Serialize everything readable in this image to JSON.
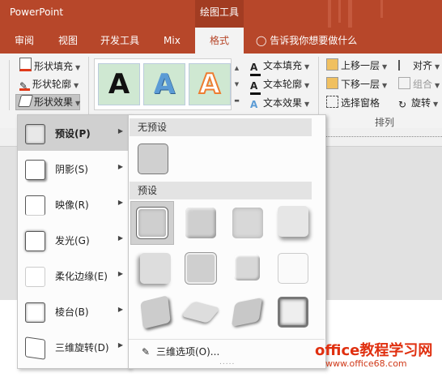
{
  "app": {
    "title": "PowerPoint",
    "context_tab": "绘图工具"
  },
  "tabs": [
    {
      "label": "审阅"
    },
    {
      "label": "视图"
    },
    {
      "label": "开发工具"
    },
    {
      "label": "Mix"
    },
    {
      "label": "格式"
    }
  ],
  "tell_me": "告诉我你想要做什么",
  "ribbon": {
    "shape_fill": "形状填充",
    "shape_outline": "形状轮廓",
    "shape_effects": "形状效果",
    "text_fill": "文本填充",
    "text_outline": "文本轮廓",
    "text_effects": "文本效果",
    "bring_forward": "上移一层",
    "send_backward": "下移一层",
    "selection_pane": "选择窗格",
    "align": "对齐",
    "group": "组合",
    "rotate": "旋转",
    "arrange_group": "排列",
    "wordart": [
      "A",
      "A",
      "A"
    ]
  },
  "effects_menu": [
    {
      "label": "预设(P)"
    },
    {
      "label": "阴影(S)"
    },
    {
      "label": "映像(R)"
    },
    {
      "label": "发光(G)"
    },
    {
      "label": "柔化边缘(E)"
    },
    {
      "label": "棱台(B)"
    },
    {
      "label": "三维旋转(D)"
    }
  ],
  "preset_panel": {
    "no_preset_header": "无预设",
    "preset_header": "预设",
    "options_link": "三维选项(O)...",
    "grip": "....."
  },
  "watermark": {
    "line1": "office教程学习网",
    "line2": "www.office68.com"
  },
  "colors": {
    "accent": "#b7472a",
    "wordart_fill": "#cfe8d2"
  }
}
